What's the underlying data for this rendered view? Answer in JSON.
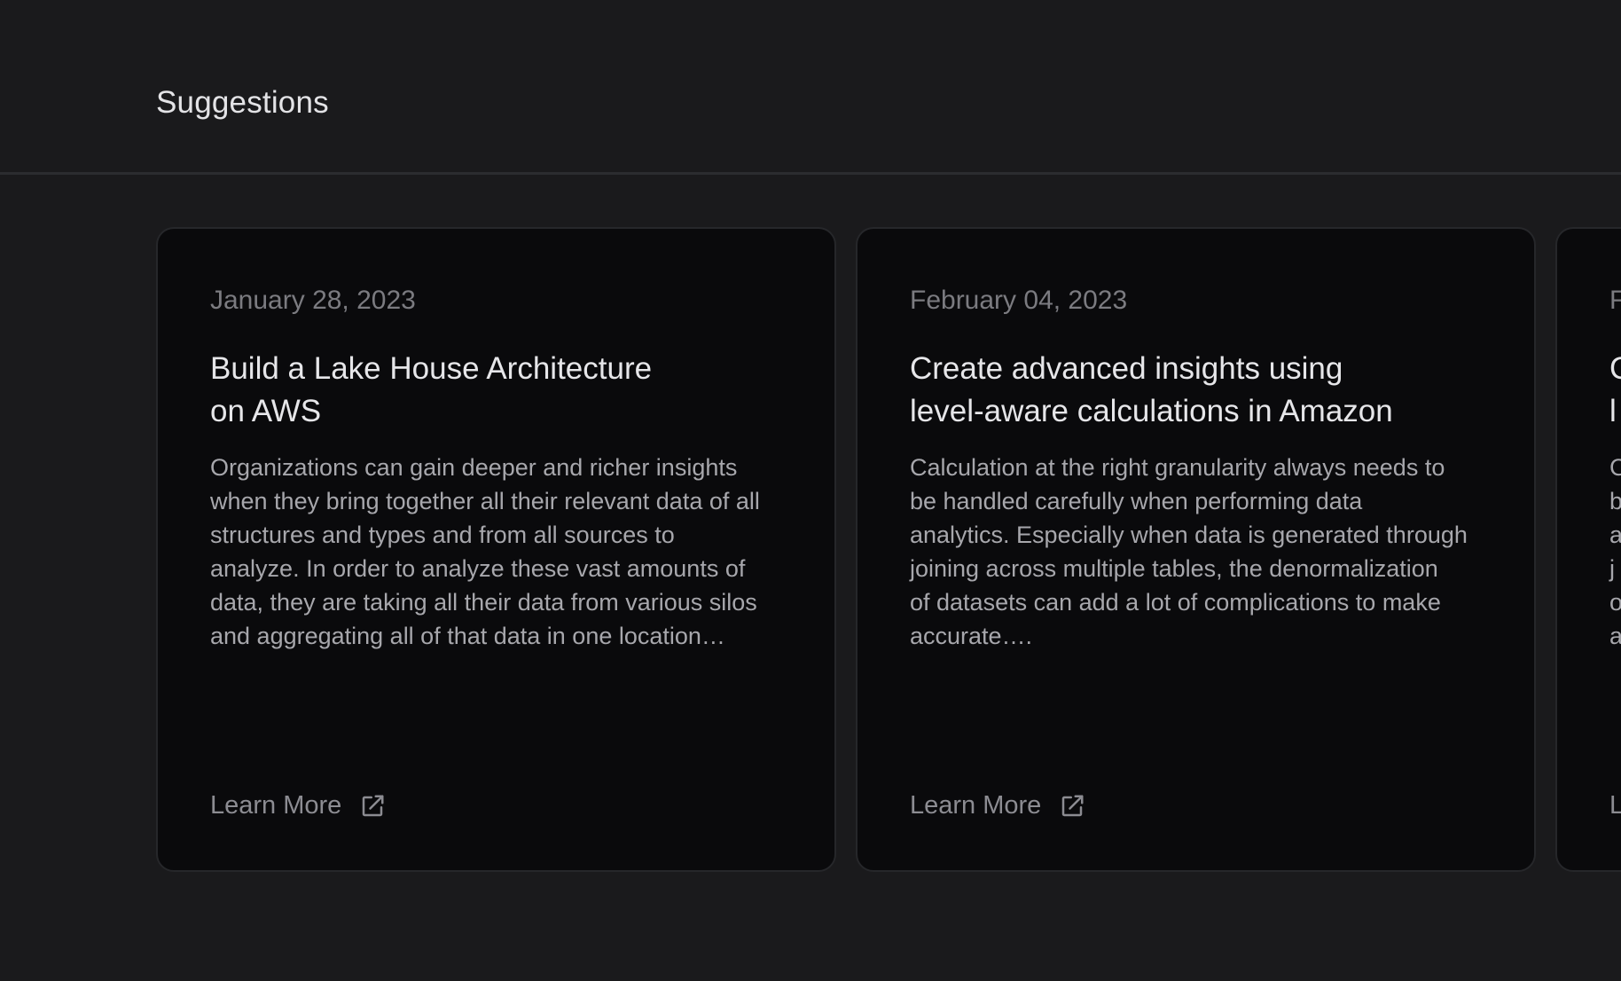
{
  "header": {
    "title": "Suggestions"
  },
  "colors": {
    "background": "#1a1a1c",
    "card_background": "#0a0a0c",
    "divider": "#2b2c2f"
  },
  "cards": [
    {
      "date": "January 28, 2023",
      "title_lines": [
        "Build a Lake House Architecture",
        "on AWS"
      ],
      "description_lines": [
        "Organizations can gain deeper and richer insights",
        "when they bring together all their relevant data of all",
        "structures and types and from all sources to",
        "analyze. In order to analyze these vast amounts of",
        "data, they are taking all their data from various silos",
        "and aggregating all of that data in one location…"
      ],
      "link_label": "Learn More",
      "link_icon": "external-link-icon"
    },
    {
      "date": "February 04, 2023",
      "title_lines": [
        "Create advanced insights using",
        "level-aware calculations in Amazon"
      ],
      "description_lines": [
        "Calculation at the right granularity always needs to",
        "be handled carefully when performing data",
        "analytics. Especially when data is generated through",
        "joining across multiple tables, the denormalization",
        "of datasets can add a lot of complications to make",
        "accurate…."
      ],
      "link_label": "Learn More",
      "link_icon": "external-link-icon"
    },
    {
      "date": "F",
      "title_lines": [
        "C",
        "l"
      ],
      "description_lines": [
        "C",
        "b",
        "a",
        "j",
        "o",
        "a"
      ],
      "link_label": "L",
      "link_icon": "external-link-icon"
    }
  ]
}
